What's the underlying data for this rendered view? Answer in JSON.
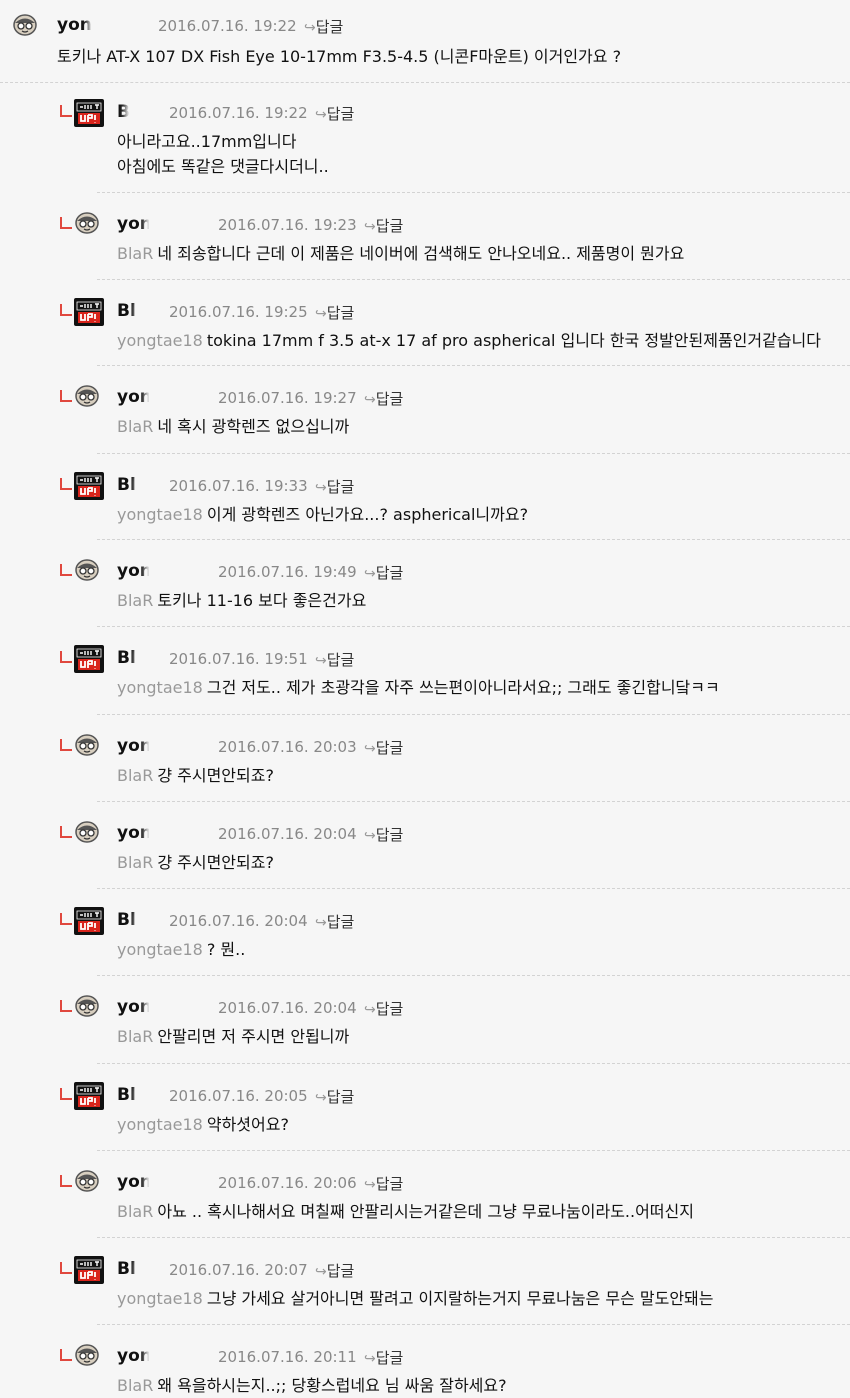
{
  "reply_label": "답글",
  "top_comment": {
    "author": "yon",
    "date": "2016.07.16. 19:22",
    "text": "토키나 AT-X 107 DX Fish Eye 10-17mm F3.5-4.5 (니콘F마운트) 이거인가요 ?"
  },
  "replies": [
    {
      "avatar": "shut",
      "author": "B",
      "date": "2016.07.16. 19:22",
      "mention": "",
      "lines": [
        "아니라고요..17mm입니다",
        "아침에도 똑같은 댓글다시더니.."
      ]
    },
    {
      "avatar": "yong",
      "author": "yon",
      "date": "2016.07.16. 19:23",
      "mention": "BlaR",
      "lines": [
        "네 죄송합니다 근데 이 제품은 네이버에 검색해도 안나오네요.. 제품명이 뭔가요"
      ]
    },
    {
      "avatar": "shut",
      "author": "Bl",
      "date": "2016.07.16. 19:25",
      "mention": "yongtae18",
      "lines": [
        "tokina 17mm f 3.5 at-x 17 af pro aspherical 입니다 한국 정발안된제품인거같습니다"
      ]
    },
    {
      "avatar": "yong",
      "author": "yon",
      "date": "2016.07.16. 19:27",
      "mention": "BlaR",
      "lines": [
        "네 혹시 광학렌즈 없으십니까"
      ]
    },
    {
      "avatar": "shut",
      "author": "Bl",
      "date": "2016.07.16. 19:33",
      "mention": "yongtae18",
      "lines": [
        "이게 광학렌즈 아닌가요...? aspherical니까요?"
      ]
    },
    {
      "avatar": "yong",
      "author": "yon",
      "date": "2016.07.16. 19:49",
      "mention": "BlaR",
      "lines": [
        "토키나 11-16 보다 좋은건가요"
      ]
    },
    {
      "avatar": "shut",
      "author": "Bl",
      "date": "2016.07.16. 19:51",
      "mention": "yongtae18",
      "lines": [
        "그건 저도.. 제가 초광각을 자주 쓰는편이아니라서요;; 그래도 좋긴합니닼ㅋㅋ"
      ]
    },
    {
      "avatar": "yong",
      "author": "yon",
      "date": "2016.07.16. 20:03",
      "mention": "BlaR",
      "lines": [
        "걍 주시면안되죠?"
      ]
    },
    {
      "avatar": "yong",
      "author": "yon",
      "date": "2016.07.16. 20:04",
      "mention": "BlaR",
      "lines": [
        "걍 주시면안되죠?"
      ]
    },
    {
      "avatar": "shut",
      "author": "Bl",
      "date": "2016.07.16. 20:04",
      "mention": "yongtae18",
      "lines": [
        "? 뭔.."
      ]
    },
    {
      "avatar": "yong",
      "author": "yon",
      "date": "2016.07.16. 20:04",
      "mention": "BlaR",
      "lines": [
        "안팔리면 저 주시면 안됩니까"
      ]
    },
    {
      "avatar": "shut",
      "author": "Bl",
      "date": "2016.07.16. 20:05",
      "mention": "yongtae18",
      "lines": [
        "약하셧어요?"
      ]
    },
    {
      "avatar": "yong",
      "author": "yon",
      "date": "2016.07.16. 20:06",
      "mention": "BlaR",
      "lines": [
        "아뇨 .. 혹시나해서요 며칠째 안팔리시는거같은데 그냥 무료나눔이라도..어떠신지"
      ]
    },
    {
      "avatar": "shut",
      "author": "Bl",
      "date": "2016.07.16. 20:07",
      "mention": "yongtae18",
      "lines": [
        "그냥 가세요 살거아니면 팔려고 이지랄하는거지 무료나눔은 무슨 말도안돼는"
      ]
    },
    {
      "avatar": "yong",
      "author": "yon",
      "date": "2016.07.16. 20:11",
      "mention": "BlaR",
      "lines": [
        "왜 욕을하시는지..;; 당황스럽네요 님 싸움 잘하세요?"
      ]
    }
  ]
}
